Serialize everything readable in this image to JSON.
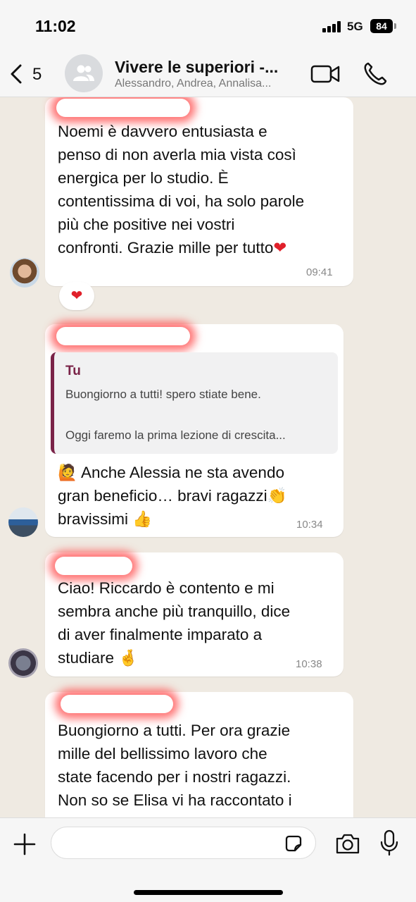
{
  "status_bar": {
    "time": "11:02",
    "network": "5G",
    "battery": "84"
  },
  "header": {
    "back_count": "5",
    "title": "Vivere le superiori -...",
    "subtitle": "Alessandro, Andrea, Annalisa...",
    "icons": [
      "chevron-left-icon",
      "group-icon",
      "video-icon",
      "phone-icon"
    ]
  },
  "messages": [
    {
      "lines": [
        "Noemi è davvero entusiasta e",
        "penso di non averla mia vista così",
        "energica per lo studio. È",
        "contentissima di voi, ha solo parole",
        "più che positive nei vostri",
        "confronti. Grazie mille per tutto"
      ],
      "trailing_emoji": "❤",
      "time": "09:41",
      "reaction": "❤"
    },
    {
      "quote": {
        "author": "Tu",
        "line1": "Buongiorno a tutti! spero stiate bene.",
        "line2": "Oggi faremo la prima lezione di crescita..."
      },
      "lines": [
        "🙋 Anche Alessia ne sta avendo",
        "gran beneficio… bravi ragazzi👏",
        "bravissimi 👍"
      ],
      "time": "10:34"
    },
    {
      "lines": [
        "Ciao! Riccardo è contento e mi",
        "sembra anche più tranquillo, dice",
        "di aver finalmente imparato a",
        "studiare 🤞"
      ],
      "time": "10:38"
    },
    {
      "lines": [
        "Buongiorno a tutti. Per ora grazie",
        "mille del bellissimo lavoro che",
        "state facendo per i nostri ragazzi.",
        "Non so se Elisa vi ha raccontato i"
      ]
    }
  ],
  "composer": {
    "placeholder": "",
    "icons": [
      "plus-icon",
      "sticker-icon",
      "camera-icon",
      "microphone-icon"
    ]
  },
  "colors": {
    "chat_background": "#efeae2",
    "bubble": "#ffffff",
    "quote_accent": "#7a2348",
    "redaction_glow": "#ff4646"
  }
}
